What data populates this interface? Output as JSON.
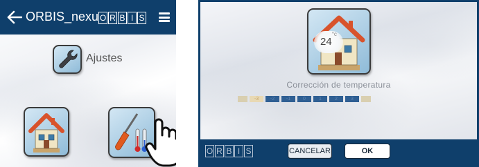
{
  "left_panel": {
    "header": {
      "title": "ORBIS_nexu",
      "logo_letters": [
        "O",
        "R",
        "B",
        "I",
        "S"
      ],
      "back_icon": "arrow-left-icon",
      "menu_icon": "hamburger-menu-icon",
      "background_color": "#0f3f6b"
    },
    "settings": {
      "label": "Ajustes",
      "icon": "wrench-icon"
    },
    "tiles": [
      {
        "icon": "house-icon"
      },
      {
        "icon": "screwdriver-thermometer-icon"
      }
    ],
    "pointer_icon": "hand-pointer-icon"
  },
  "right_panel": {
    "temperature": {
      "value": "24",
      "unit": "°c",
      "icon": "house-thermostat-icon"
    },
    "title": "Corrección de temperatura",
    "scale": {
      "segments": [
        "",
        "-3",
        "-2",
        "-1",
        "0",
        "1",
        "2",
        "3",
        ""
      ],
      "selected_index": 1
    },
    "footer": {
      "logo_letters": [
        "O",
        "R",
        "B",
        "I",
        "S"
      ],
      "cancel_label": "CANCELAR",
      "ok_label": "OK"
    }
  },
  "colors": {
    "brand_navy": "#0f3f6b",
    "tile_blue": "#8fbbd8",
    "scale_blue": "#2f5f93",
    "scale_selected": "#e8d9b4"
  }
}
